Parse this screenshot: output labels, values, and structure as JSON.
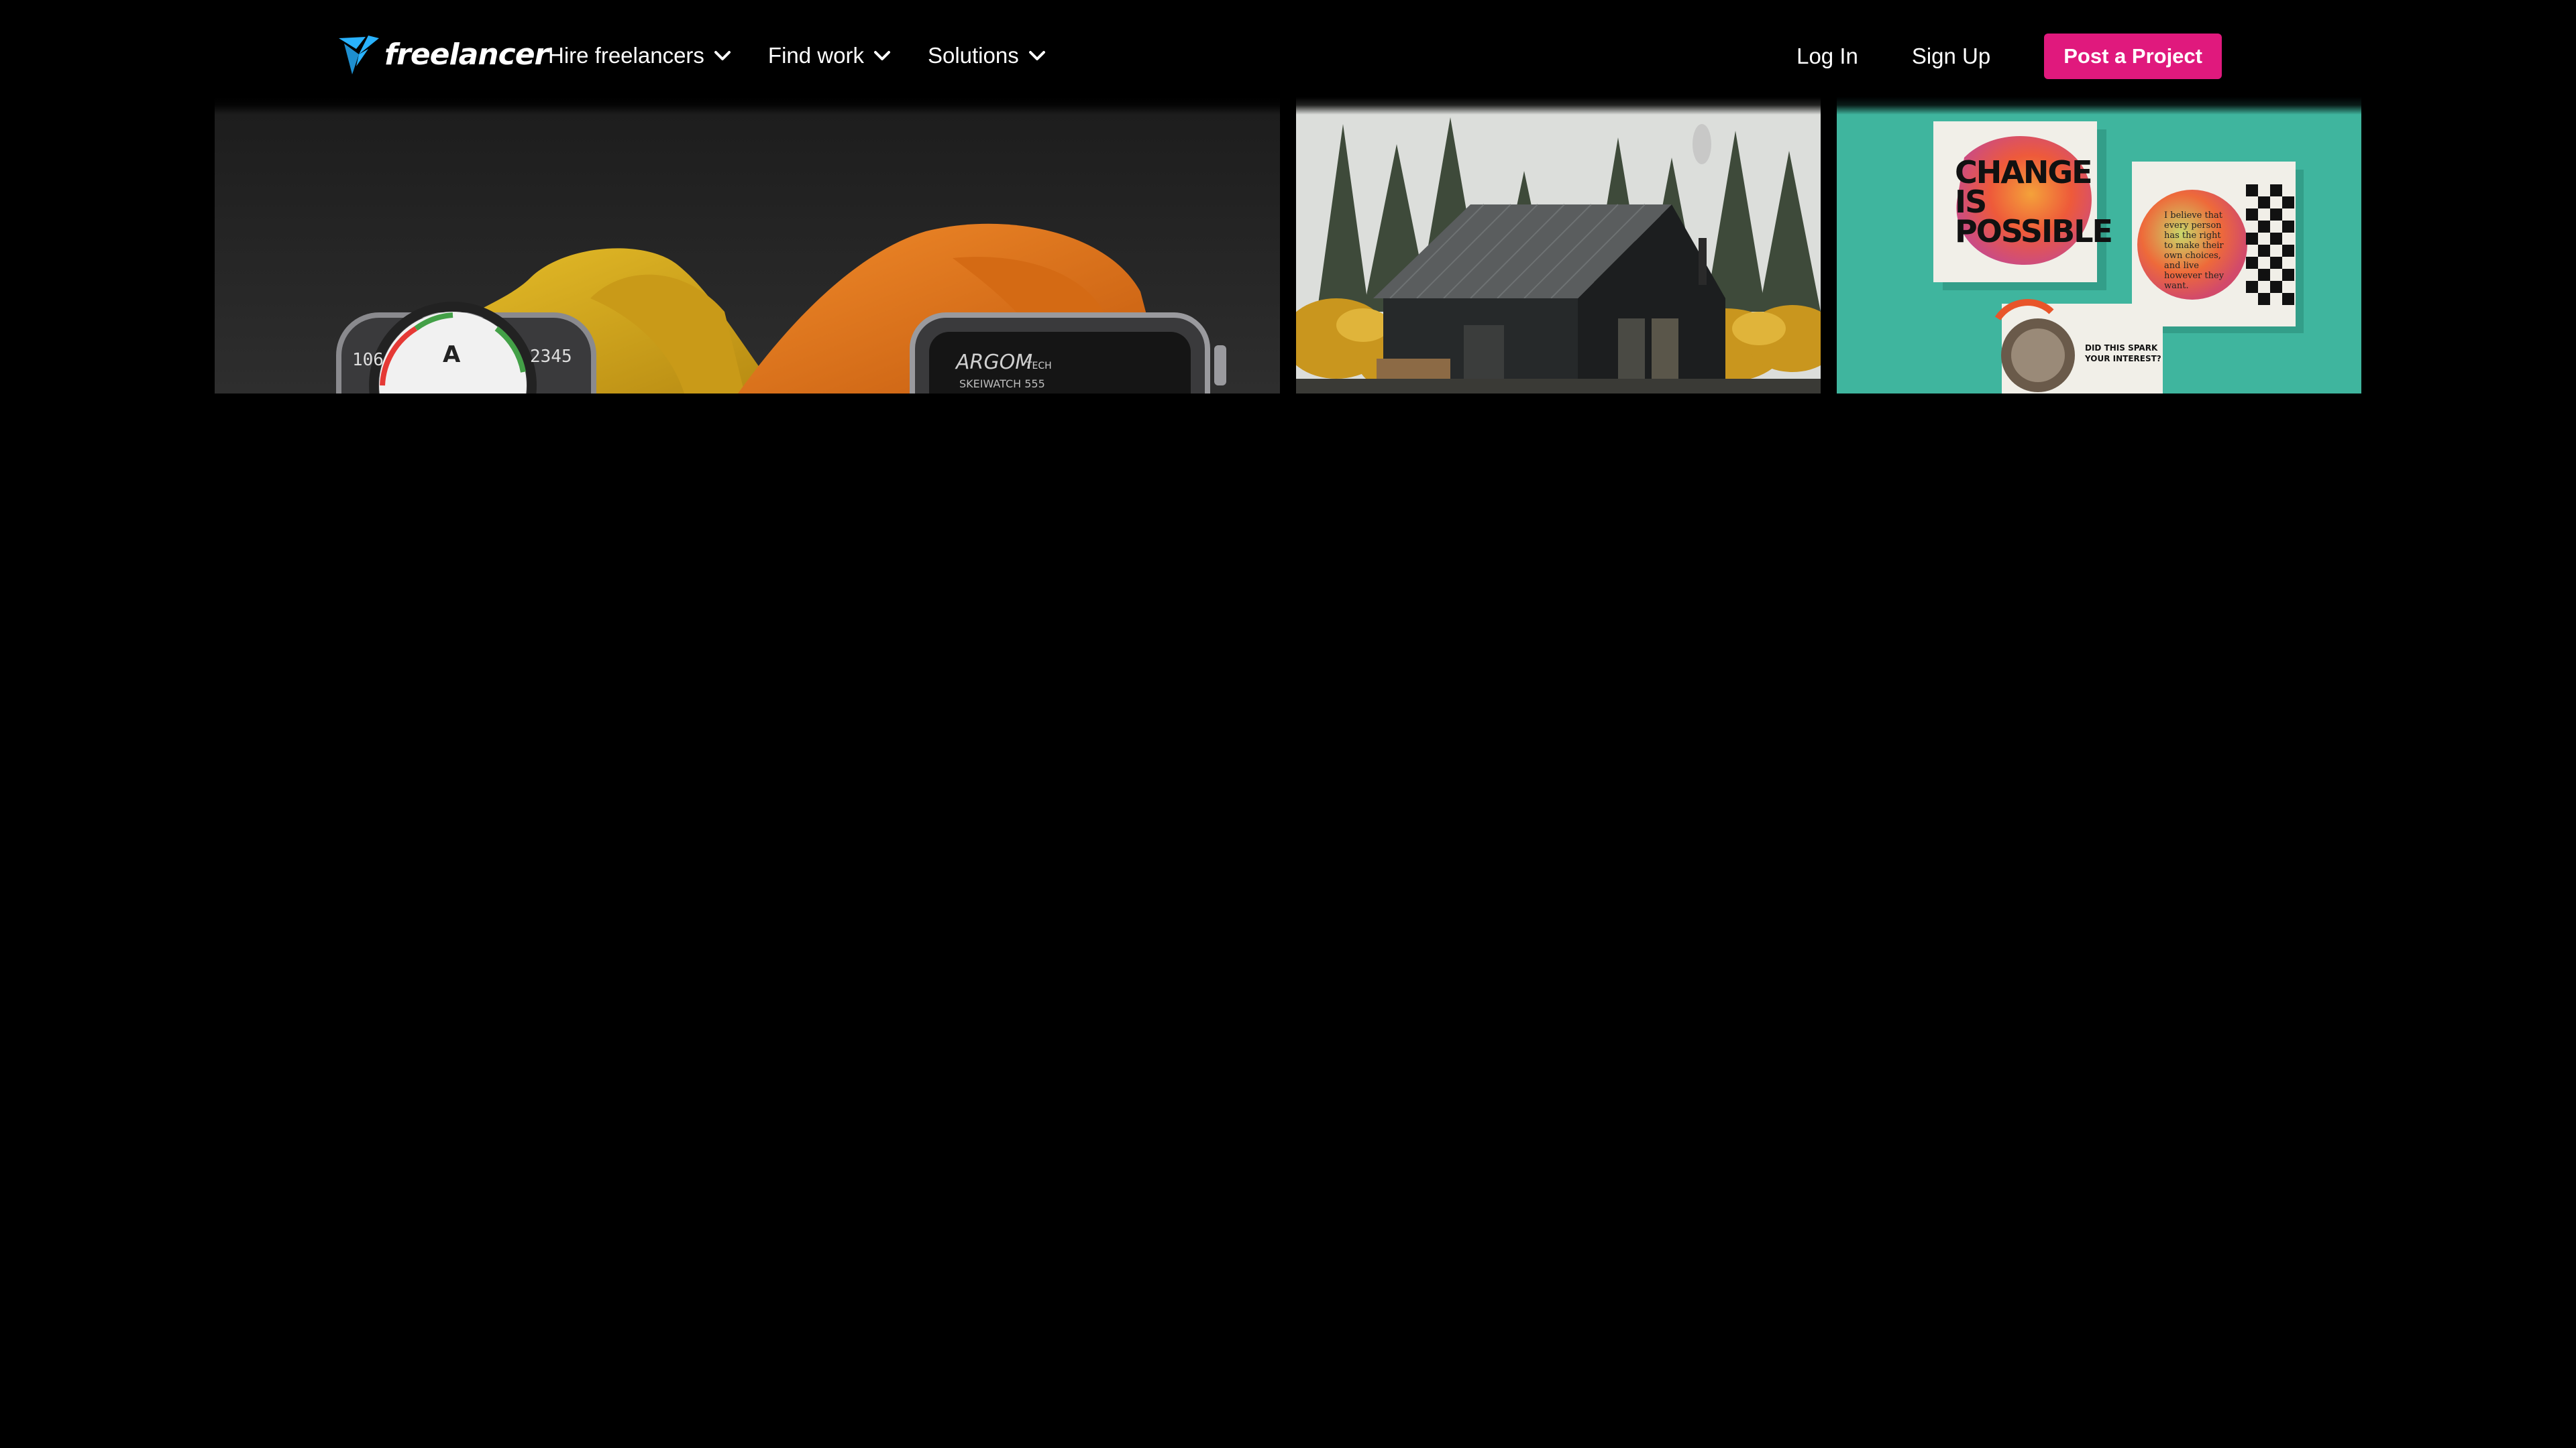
{
  "brand": {
    "name": "freelancer",
    "accent_color": "#29b2fe",
    "logo_icon": "bird-logo-icon"
  },
  "nav": {
    "items": [
      {
        "label": "Hire freelancers",
        "icon": "chevron-down-icon"
      },
      {
        "label": "Find work",
        "icon": "chevron-down-icon"
      },
      {
        "label": "Solutions",
        "icon": "chevron-down-icon"
      }
    ]
  },
  "auth": {
    "login_label": "Log In",
    "signup_label": "Sign Up",
    "post_project_label": "Post a Project",
    "post_project_color": "#e0197d"
  },
  "gallery": {
    "watch": {
      "left_dial_numbers": [
        "106",
        "2345"
      ],
      "right_brand": "ARGOM",
      "right_brand_suffix": "TECH",
      "right_model": "SKEIWATCH 555"
    },
    "poster": {
      "headline_line1": "CHANGE",
      "headline_line2": "IS",
      "headline_line3": "POSSIBLE",
      "quote_lines": [
        "I believe that",
        "every person",
        "has the right",
        "to make their",
        "own choices,",
        "and live",
        "however they",
        "want."
      ],
      "card_lines": [
        "DID THIS SPARK",
        "YOUR INTEREST?"
      ]
    }
  }
}
